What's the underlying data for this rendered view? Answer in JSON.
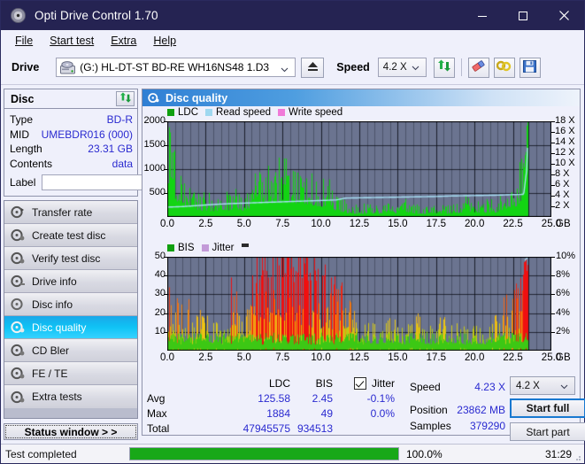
{
  "window": {
    "title": "Opti Drive Control 1.70",
    "icon": "disc-icon",
    "minimize": "minimize-icon",
    "maximize": "maximize-icon",
    "close": "close-icon"
  },
  "menu": {
    "items": [
      "File",
      "Start test",
      "Extra",
      "Help"
    ]
  },
  "toolbar": {
    "drive_label": "Drive",
    "drive_value": "(G:)  HL-DT-ST BD-RE  WH16NS48 1.D3",
    "eject": "eject-icon",
    "speed_label": "Speed",
    "speed_value": "4.2 X",
    "refresh": "refresh-icon",
    "erase": "erase-icon",
    "bitsetting": "bitsetting-icon",
    "save": "save-icon"
  },
  "disc": {
    "title": "Disc",
    "refresh": "refresh-icon",
    "rows": [
      {
        "key": "Type",
        "value": "BD-R"
      },
      {
        "key": "MID",
        "value": "UMEBDR016 (000)"
      },
      {
        "key": "Length",
        "value": "23.31 GB"
      },
      {
        "key": "Contents",
        "value": "data"
      }
    ],
    "label_key": "Label",
    "label_value": "",
    "label_button": "disc-label-icon"
  },
  "nav": {
    "items": [
      {
        "label": "Transfer rate",
        "selected": false
      },
      {
        "label": "Create test disc",
        "selected": false
      },
      {
        "label": "Verify test disc",
        "selected": false
      },
      {
        "label": "Drive info",
        "selected": false
      },
      {
        "label": "Disc info",
        "selected": false
      },
      {
        "label": "Disc quality",
        "selected": true
      },
      {
        "label": "CD Bler",
        "selected": false
      },
      {
        "label": "FE / TE",
        "selected": false
      },
      {
        "label": "Extra tests",
        "selected": false
      }
    ],
    "status_window": "Status window > >"
  },
  "panel": {
    "title": "Disc quality",
    "icon": "disc-quality-icon"
  },
  "chart_data": [
    {
      "type": "area",
      "name": "ldc-chart",
      "title": "",
      "legend": [
        {
          "label": "LDC",
          "color": "#10a010"
        },
        {
          "label": "Read speed",
          "color": "#9fd8f0"
        },
        {
          "label": "Write speed",
          "color": "#f07ad8"
        }
      ],
      "legend_position": "top-left",
      "xlabel": "GB",
      "xlim": [
        0,
        25
      ],
      "xticks": [
        0.0,
        2.5,
        5.0,
        7.5,
        10.0,
        12.5,
        15.0,
        17.5,
        20.0,
        22.5,
        25.0
      ],
      "xticklabels": [
        "0.0",
        "2.5",
        "5.0",
        "7.5",
        "10.0",
        "12.5",
        "15.0",
        "17.5",
        "20.0",
        "22.5",
        "25.0"
      ],
      "ylabel_left": "LDC",
      "ylim": [
        0,
        2000
      ],
      "yticks": [
        500,
        1000,
        1500,
        2000
      ],
      "yticklabels": [
        "500",
        "1000",
        "1500",
        "2000"
      ],
      "ylabel_right": "X",
      "ylim_right": [
        0,
        18
      ],
      "yticks_right": [
        2,
        4,
        6,
        8,
        10,
        12,
        14,
        16,
        18
      ],
      "yticklabels_right": [
        "2 X",
        "4 X",
        "6 X",
        "8 X",
        "10 X",
        "12 X",
        "14 X",
        "16 X",
        "18 X"
      ],
      "grid": true,
      "data_end_gb": 23.5,
      "series": [
        {
          "name": "LDC",
          "color": "#10c010",
          "x": [
            0.0,
            0.15,
            0.3,
            0.45,
            0.6,
            0.8,
            1.0,
            1.2,
            1.45,
            1.7,
            2.0,
            2.3,
            2.6,
            2.9,
            3.2,
            3.5,
            3.8,
            4.1,
            4.4,
            4.7,
            5.0,
            5.3,
            5.6,
            5.9,
            6.2,
            6.5,
            6.8,
            7.1,
            7.4,
            7.7,
            8.0,
            8.3,
            8.6,
            8.9,
            9.2,
            9.5,
            9.8,
            10.1,
            10.4,
            10.7,
            11.0,
            11.3,
            11.7,
            12.1,
            12.5,
            13.0,
            13.5,
            14.0,
            14.5,
            15.0,
            15.5,
            16.0,
            16.5,
            17.0,
            17.5,
            18.0,
            18.5,
            19.0,
            19.4,
            19.8,
            20.2,
            20.6,
            21.0,
            21.4,
            21.8,
            22.1,
            22.4,
            22.7,
            22.95,
            23.15,
            23.3,
            23.42,
            23.5
          ],
          "values": [
            640,
            1280,
            900,
            1050,
            700,
            760,
            560,
            430,
            620,
            380,
            330,
            300,
            350,
            290,
            330,
            300,
            360,
            320,
            380,
            350,
            300,
            430,
            560,
            640,
            700,
            730,
            690,
            760,
            820,
            790,
            730,
            700,
            760,
            690,
            640,
            600,
            560,
            520,
            620,
            430,
            300,
            260,
            200,
            170,
            150,
            180,
            160,
            170,
            200,
            180,
            260,
            170,
            160,
            150,
            190,
            170,
            160,
            200,
            300,
            260,
            230,
            200,
            250,
            220,
            340,
            260,
            430,
            560,
            760,
            1000,
            1400,
            1900,
            1880
          ]
        },
        {
          "name": "Read speed",
          "color": "#a8e0f5",
          "x": [
            0.0,
            1.0,
            2.0,
            3.0,
            4.0,
            5.0,
            6.0,
            7.0,
            8.0,
            9.0,
            10.0,
            11.0,
            11.6,
            12.5,
            13.5,
            14.5,
            15.5,
            16.5,
            17.5,
            18.5,
            19.5,
            20.5,
            21.5,
            22.5,
            23.2,
            23.4,
            23.5
          ],
          "values": [
            1.85,
            1.95,
            2.15,
            2.35,
            2.5,
            2.6,
            2.7,
            2.8,
            2.9,
            3.0,
            3.1,
            3.2,
            3.55,
            3.6,
            3.65,
            3.7,
            3.75,
            3.8,
            3.85,
            3.95,
            4.0,
            4.05,
            4.1,
            4.2,
            4.25,
            9.0,
            18.0
          ]
        }
      ]
    },
    {
      "type": "area",
      "name": "bis-chart",
      "title": "",
      "legend": [
        {
          "label": "BIS",
          "color": "#10a010"
        },
        {
          "label": "Jitter",
          "color": "#c39ad8"
        }
      ],
      "legend_position": "top-left",
      "xlabel": "GB",
      "xlim": [
        0,
        25
      ],
      "xticks": [
        0.0,
        2.5,
        5.0,
        7.5,
        10.0,
        12.5,
        15.0,
        17.5,
        20.0,
        22.5,
        25.0
      ],
      "xticklabels": [
        "0.0",
        "2.5",
        "5.0",
        "7.5",
        "10.0",
        "12.5",
        "15.0",
        "17.5",
        "20.0",
        "22.5",
        "25.0"
      ],
      "ylabel_left": "BIS",
      "ylim": [
        0,
        50
      ],
      "yticks": [
        10,
        20,
        30,
        40,
        50
      ],
      "yticklabels": [
        "10",
        "20",
        "30",
        "40",
        "50"
      ],
      "ylabel_right": "%",
      "ylim_right": [
        0,
        10
      ],
      "yticks_right": [
        2,
        4,
        6,
        8,
        10
      ],
      "yticklabels_right": [
        "2%",
        "4%",
        "6%",
        "8%",
        "10%"
      ],
      "grid": true,
      "data_end_gb": 23.5,
      "series": [
        {
          "name": "BIS",
          "color_low": "#3cc814",
          "color_mid": "#e8c818",
          "color_high": "#e03010",
          "x": [
            0.0,
            0.15,
            0.3,
            0.5,
            0.7,
            0.9,
            1.1,
            1.4,
            1.7,
            2.0,
            2.3,
            2.6,
            2.9,
            3.2,
            3.5,
            3.8,
            4.1,
            4.3,
            4.6,
            4.9,
            5.2,
            5.5,
            5.8,
            6.1,
            6.4,
            6.7,
            7.0,
            7.3,
            7.6,
            7.9,
            8.2,
            8.5,
            8.8,
            9.1,
            9.4,
            9.7,
            10.0,
            10.3,
            10.6,
            10.9,
            11.2,
            11.5,
            11.8,
            12.2,
            12.6,
            13.0,
            13.5,
            14.0,
            14.5,
            15.0,
            15.5,
            16.0,
            16.3,
            16.6,
            17.0,
            17.5,
            18.0,
            18.5,
            19.0,
            19.4,
            19.8,
            20.2,
            20.6,
            21.0,
            21.4,
            21.7,
            22.0,
            22.3,
            22.6,
            22.9,
            23.1,
            23.25,
            23.38,
            23.48
          ],
          "values": [
            26,
            21,
            19,
            14,
            20,
            17,
            10,
            19,
            12,
            16,
            11,
            13,
            10,
            12,
            9,
            14,
            22,
            27,
            16,
            18,
            19,
            26,
            33,
            43,
            36,
            38,
            42,
            44,
            40,
            43,
            35,
            38,
            32,
            36,
            30,
            33,
            28,
            31,
            26,
            24,
            23,
            21,
            18,
            13,
            11,
            10,
            9,
            8,
            11,
            9,
            8,
            10,
            15,
            9,
            8,
            10,
            12,
            9,
            11,
            7,
            8,
            9,
            7,
            10,
            13,
            17,
            19,
            15,
            21,
            30,
            38,
            45,
            48,
            47
          ]
        }
      ]
    }
  ],
  "stats": {
    "col_ldc": "LDC",
    "col_bis": "BIS",
    "jitter_label": "Jitter",
    "jitter_checked": true,
    "rows": [
      {
        "key": "Avg",
        "ldc": "125.58",
        "bis": "2.45",
        "jitter": "-0.1%"
      },
      {
        "key": "Max",
        "ldc": "1884",
        "bis": "49",
        "jitter": "0.0%"
      },
      {
        "key": "Total",
        "ldc": "47945575",
        "bis": "934513",
        "jitter": ""
      }
    ],
    "speed_key": "Speed",
    "speed_value": "4.23 X",
    "position_key": "Position",
    "position_value": "23862 MB",
    "samples_key": "Samples",
    "samples_value": "379290",
    "speed_select": "4.2 X",
    "start_full": "Start full",
    "start_part": "Start part"
  },
  "statusbar": {
    "message": "Test completed",
    "progress_pct": 100.0,
    "progress_text": "100.0%",
    "elapsed": "31:29"
  }
}
